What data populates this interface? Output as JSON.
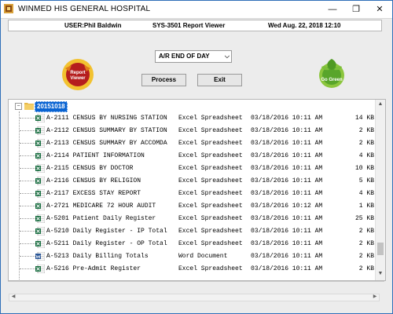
{
  "window": {
    "title": "WINMED HIS GENERAL HOSPITAL",
    "controls": {
      "minimize": "—",
      "maximize": "❐",
      "close": "✕"
    }
  },
  "infobar": {
    "user": "USER:Phil Baldwin",
    "system": "SYS-3501   Report Viewer",
    "datetime": "Wed Aug. 22, 2018 12:10"
  },
  "logos": {
    "left_icon": "report-viewer-logo",
    "left_text": "Report Viewer",
    "right_icon": "go-green-logo",
    "right_text": "Go Green"
  },
  "report_select": {
    "value": "A/R END OF DAY",
    "arrow": "⌵"
  },
  "buttons": {
    "process": "Process",
    "exit": "Exit"
  },
  "tree": {
    "expander": "−",
    "folder": "20151018",
    "rows": [
      {
        "name": "A-2111 CENSUS BY NURSING STATION",
        "type": "Excel Spreadsheet",
        "date": "03/18/2016 10:11 AM",
        "size": "14 KB",
        "icon": "excel-file-icon"
      },
      {
        "name": "A-2112 CENSUS SUMMARY BY STATION",
        "type": "Excel Spreadsheet",
        "date": "03/18/2016 10:11 AM",
        "size": "2 KB",
        "icon": "excel-file-icon"
      },
      {
        "name": "A-2113 CENSUS SUMMARY BY ACCOMDA",
        "type": "Excel Spreadsheet",
        "date": "03/18/2016 10:11 AM",
        "size": "2 KB",
        "icon": "excel-file-icon"
      },
      {
        "name": "A-2114 PATIENT INFORMATION",
        "type": "Excel Spreadsheet",
        "date": "03/18/2016 10:11 AM",
        "size": "4 KB",
        "icon": "excel-file-icon"
      },
      {
        "name": "A-2115 CENSUS BY DOCTOR",
        "type": "Excel Spreadsheet",
        "date": "03/18/2016 10:11 AM",
        "size": "10 KB",
        "icon": "excel-file-icon"
      },
      {
        "name": "A-2116 CENSUS BY RELIGION",
        "type": "Excel Spreadsheet",
        "date": "03/18/2016 10:11 AM",
        "size": "5 KB",
        "icon": "excel-file-icon"
      },
      {
        "name": "A-2117 EXCESS STAY REPORT",
        "type": "Excel Spreadsheet",
        "date": "03/18/2016 10:11 AM",
        "size": "4 KB",
        "icon": "excel-file-icon"
      },
      {
        "name": "A-2721 MEDICARE 72 HOUR AUDIT",
        "type": "Excel Spreadsheet",
        "date": "03/18/2016 10:12 AM",
        "size": "1 KB",
        "icon": "excel-file-icon"
      },
      {
        "name": "A-5201 Patient Daily Register",
        "type": "Excel Spreadsheet",
        "date": "03/18/2016 10:11 AM",
        "size": "25 KB",
        "icon": "excel-file-icon"
      },
      {
        "name": "A-5210 Daily Register - IP Total",
        "type": "Excel Spreadsheet",
        "date": "03/18/2016 10:11 AM",
        "size": "2 KB",
        "icon": "excel-file-icon"
      },
      {
        "name": "A-5211 Daily Register - OP Total",
        "type": "Excel Spreadsheet",
        "date": "03/18/2016 10:11 AM",
        "size": "2 KB",
        "icon": "excel-file-icon"
      },
      {
        "name": "A-5213 Daily Billing Totals",
        "type": "Word Document",
        "date": "03/18/2016 10:11 AM",
        "size": "2 KB",
        "icon": "word-file-icon"
      },
      {
        "name": "A-5216 Pre-Admit Register",
        "type": "Excel Spreadsheet",
        "date": "03/18/2016 10:11 AM",
        "size": "2 KB",
        "icon": "excel-file-icon"
      }
    ]
  },
  "scroll_arrows": {
    "up": "▲",
    "down": "▼",
    "left": "◀",
    "right": "▶"
  },
  "colors": {
    "selection": "#0a64d2",
    "excel": "#1e7145",
    "word": "#2b5797"
  }
}
